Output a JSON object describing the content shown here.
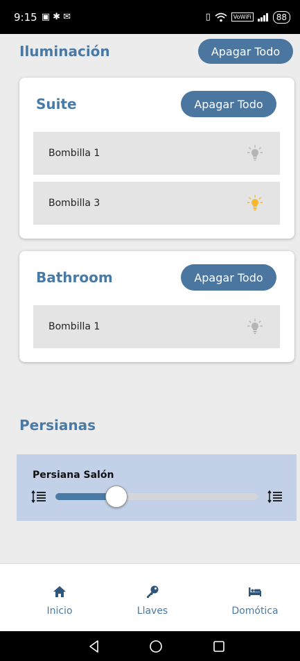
{
  "status_bar": {
    "time": "9:15",
    "battery": "88"
  },
  "lighting": {
    "title": "Iluminación",
    "turn_off_all": "Apagar Todo",
    "rooms": [
      {
        "name": "Suite",
        "turn_off_all": "Apagar Todo",
        "bulbs": [
          {
            "label": "Bombilla 1",
            "state": "off",
            "color": "#b5b5b5"
          },
          {
            "label": "Bombilla 3",
            "state": "on",
            "color": "#f5b82e"
          }
        ]
      },
      {
        "name": "Bathroom",
        "turn_off_all": "Apagar Todo",
        "bulbs": [
          {
            "label": "Bombilla 1",
            "state": "off",
            "color": "#b5b5b5"
          }
        ]
      }
    ]
  },
  "blinds": {
    "title": "Persianas",
    "items": [
      {
        "name": "Persiana Salón",
        "level_percent": 30
      }
    ]
  },
  "tab_bar": {
    "tabs": [
      {
        "label": "Inicio",
        "icon": "home-icon"
      },
      {
        "label": "Llaves",
        "icon": "key-icon"
      },
      {
        "label": "Domótica",
        "icon": "bed-icon"
      }
    ]
  },
  "colors": {
    "accent": "#4a79a3",
    "button": "#4a76a0",
    "blind_panel": "#c2d1e7"
  }
}
